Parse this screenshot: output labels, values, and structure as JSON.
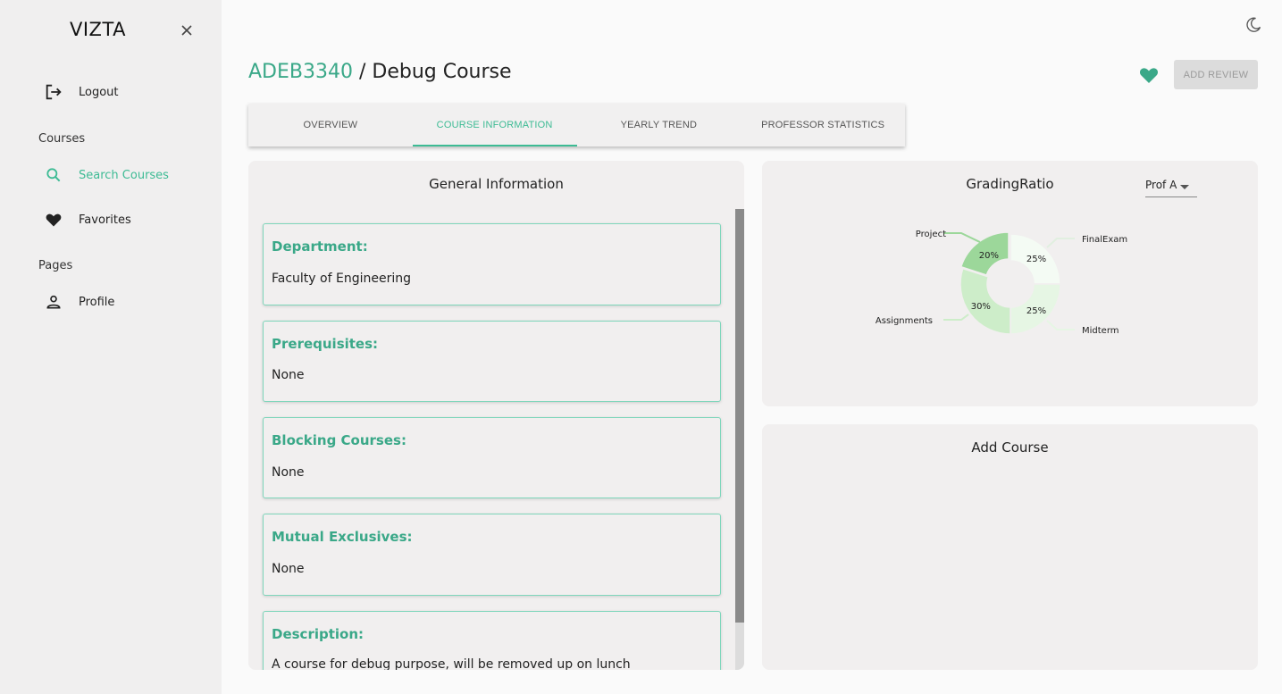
{
  "sidebar": {
    "brand": "VIZTA",
    "logout": "Logout",
    "courses_section": "Courses",
    "search_courses": "Search Courses",
    "favorites": "Favorites",
    "pages_section": "Pages",
    "profile": "Profile"
  },
  "header": {
    "course_code": "ADEB3340",
    "separator": " / ",
    "course_name": "Debug Course",
    "add_review": "ADD REVIEW"
  },
  "tabs": [
    "OVERVIEW",
    "COURSE INFORMATION",
    "YEARLY TREND",
    "PROFESSOR STATISTICS"
  ],
  "general": {
    "title": "General Information",
    "cards": [
      {
        "label": "Department:",
        "value": "Faculty of Engineering"
      },
      {
        "label": "Prerequisites:",
        "value": "None"
      },
      {
        "label": "Blocking Courses:",
        "value": "None"
      },
      {
        "label": "Mutual Exclusives:",
        "value": "None"
      },
      {
        "label": "Description:",
        "value": "A course for debug purpose, will be removed up on lunch"
      }
    ]
  },
  "grading": {
    "title": "GradingRatio",
    "selected_prof": "Prof A"
  },
  "add_course": {
    "title": "Add Course"
  },
  "colors": {
    "accent": "#3dbb94",
    "accent_dark": "#3aa888"
  },
  "chart_data": {
    "type": "pie",
    "donut": true,
    "categories": [
      "FinalExam",
      "Midterm",
      "Assignments",
      "Project"
    ],
    "values": [
      25,
      25,
      30,
      20
    ],
    "labels": [
      "25%",
      "25%",
      "30%",
      "20%"
    ],
    "colors": [
      "#f4fbf4",
      "#e6f6e4",
      "#cdedc9",
      "#9cd79a"
    ]
  }
}
